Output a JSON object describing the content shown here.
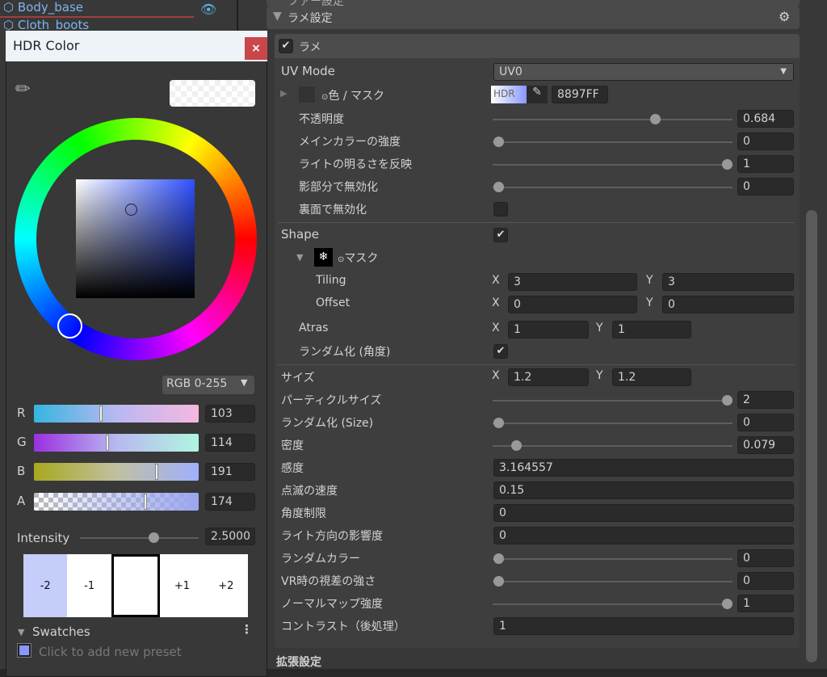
{
  "hierarchy": {
    "items": [
      "Body_base",
      "Cloth_boots"
    ]
  },
  "inspector": {
    "prev_section": "ファー設定",
    "section_title": "ラメ設定",
    "toggle_label": "ラメ",
    "uv_mode": {
      "label": "UV Mode",
      "value": "UV0"
    },
    "color_mask": {
      "label": "色 / マスク",
      "hdr": "HDR",
      "hex": "8897FF"
    },
    "sliders_a": [
      {
        "label": "不透明度",
        "value": "0.684",
        "fraction": 0.684
      },
      {
        "label": "メインカラーの強度",
        "value": "0",
        "fraction": 0
      },
      {
        "label": "ライトの明るさを反映",
        "value": "1",
        "fraction": 1
      },
      {
        "label": "影部分で無効化",
        "value": "0",
        "fraction": 0
      }
    ],
    "backface": {
      "label": "裏面で無効化",
      "checked": false
    },
    "shape": {
      "label": "Shape",
      "checked": true
    },
    "mask": {
      "label": "マスク"
    },
    "tiling": {
      "label": "Tiling",
      "x": "3",
      "y": "3"
    },
    "offset": {
      "label": "Offset",
      "x": "0",
      "y": "0"
    },
    "atras": {
      "label": "Atras",
      "x": "1",
      "y": "1"
    },
    "random_angle": {
      "label": "ランダム化 (角度)",
      "checked": true
    },
    "size": {
      "label": "サイズ",
      "x": "1.2",
      "y": "1.2"
    },
    "sliders_b": [
      {
        "label": "パーティクルサイズ",
        "value": "2",
        "fraction": 1
      },
      {
        "label": "ランダム化 (Size)",
        "value": "0",
        "fraction": 0
      },
      {
        "label": "密度",
        "value": "0.079",
        "fraction": 0.079
      }
    ],
    "fields": [
      {
        "label": "感度",
        "value": "3.164557"
      },
      {
        "label": "点滅の速度",
        "value": "0.15"
      },
      {
        "label": "角度制限",
        "value": "0"
      },
      {
        "label": "ライト方向の影響度",
        "value": "0"
      }
    ],
    "sliders_c": [
      {
        "label": "ランダムカラー",
        "value": "0",
        "fraction": 0
      },
      {
        "label": "VR時の視差の強さ",
        "value": "0",
        "fraction": 0
      },
      {
        "label": "ノーマルマップ強度",
        "value": "1",
        "fraction": 1
      }
    ],
    "contrast": {
      "label": "コントラスト（後処理）",
      "value": "1"
    },
    "extended": "拡張設定",
    "x": "X",
    "y": "Y"
  },
  "hdr_dialog": {
    "title": "HDR Color",
    "close": "×",
    "mode": "RGB 0-255",
    "channels": [
      {
        "label": "R",
        "value": "103",
        "fraction": 0.404
      },
      {
        "label": "G",
        "value": "114",
        "fraction": 0.447
      },
      {
        "label": "B",
        "value": "191",
        "fraction": 0.749
      },
      {
        "label": "A",
        "value": "174",
        "fraction": 0.682
      }
    ],
    "intensity": {
      "label": "Intensity",
      "value": "2.5000",
      "fraction": 0.75
    },
    "exposure": [
      "-2",
      "-1",
      "",
      "+1",
      "+2"
    ],
    "swatches": "Swatches",
    "add_preset": "Click to add new preset",
    "color": "#8897FF"
  }
}
